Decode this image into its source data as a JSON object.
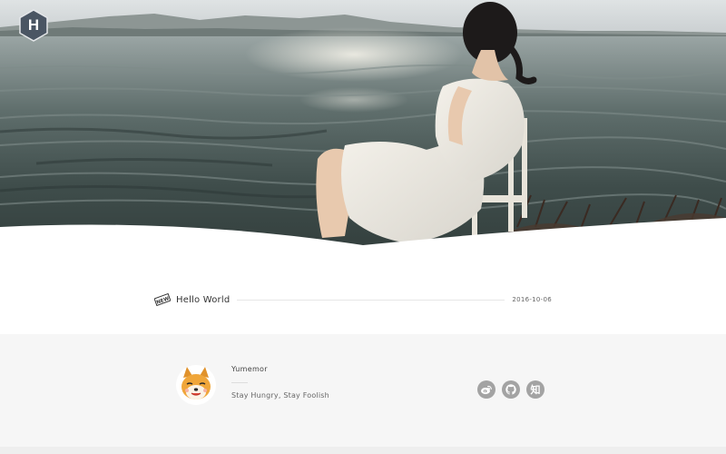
{
  "banner": {
    "logo_letter": "H"
  },
  "posts": [
    {
      "badge": "NEW",
      "title": "Hello World",
      "date": "2016-10-06"
    }
  ],
  "author": {
    "name": "Yumemor",
    "motto": "Stay Hungry, Stay Foolish"
  },
  "social": {
    "zhihu_glyph": "知"
  },
  "colors": {
    "footer_bg": "#f6f6f6",
    "social_icon_bg": "#a3a3a3",
    "logo_bg": "#4a5563"
  }
}
